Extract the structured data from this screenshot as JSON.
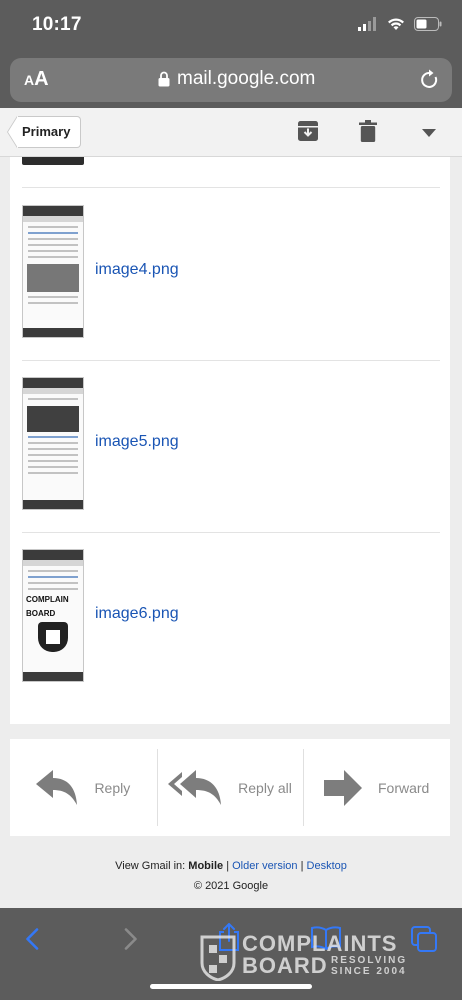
{
  "status": {
    "time": "10:17"
  },
  "browser": {
    "aa_small": "A",
    "aa_big": "A",
    "url": "mail.google.com"
  },
  "gmail_toolbar": {
    "back_label": "Primary"
  },
  "attachments": [
    {
      "name": "image4.png"
    },
    {
      "name": "image5.png"
    },
    {
      "name": "image6.png"
    }
  ],
  "thumbnail_text": {
    "logo_line1": "COMPLAIN",
    "logo_line2": "BOARD"
  },
  "actions": {
    "reply": "Reply",
    "reply_all": "Reply all",
    "forward": "Forward"
  },
  "footer": {
    "view_in_prefix": "View Gmail in:",
    "mobile": "Mobile",
    "sep1": "|",
    "older": "Older version",
    "sep2": "|",
    "desktop": "Desktop",
    "copyright": "© 2021 Google"
  },
  "watermark": {
    "line1": "COMPLAINTS",
    "line2": "BOARD",
    "side1": "RESOLVING",
    "side2": "SINCE 2004"
  },
  "colors": {
    "chrome_bg": "#5c5c5c",
    "link_blue": "#1a55b4",
    "ios_blue": "#3478f6"
  }
}
